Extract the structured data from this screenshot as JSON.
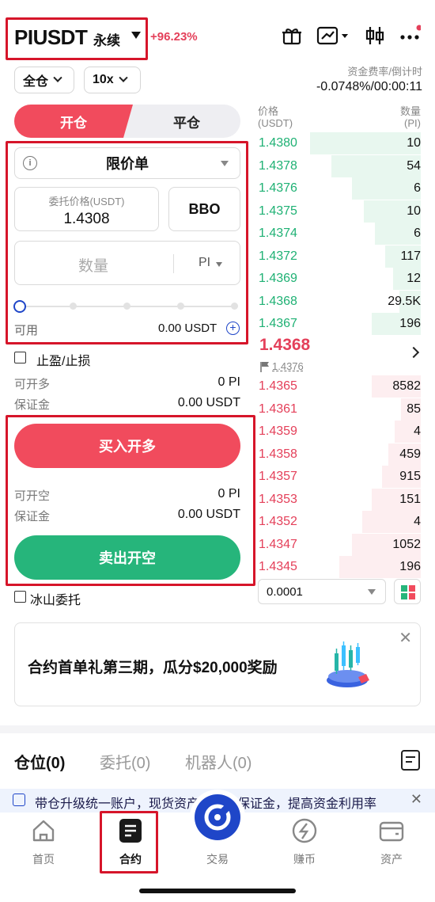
{
  "header": {
    "symbol": "PIUSDT",
    "contract_type": "永续",
    "change": "+96.23%"
  },
  "controls": {
    "margin_mode": "全仓",
    "leverage": "10x",
    "funding_label": "资金费率/倒计时",
    "funding_value": "-0.0748%/00:00:11"
  },
  "order_form": {
    "tab_open": "开仓",
    "tab_close": "平仓",
    "order_type": "限价单",
    "price_label": "委托价格(USDT)",
    "price_value": "1.4308",
    "bbo_label": "BBO",
    "qty_placeholder": "数量",
    "qty_unit": "PI",
    "available_label": "可用",
    "available_value": "0.00 USDT",
    "tpsl_label": "止盈/止损",
    "can_long_label": "可开多",
    "can_long_value": "0 PI",
    "margin_label": "保证金",
    "margin_long_value": "0.00 USDT",
    "buy_button": "买入开多",
    "can_short_label": "可开空",
    "can_short_value": "0 PI",
    "margin_short_value": "0.00 USDT",
    "sell_button": "卖出开空",
    "iceberg_label": "冰山委托"
  },
  "orderbook": {
    "price_header": "价格",
    "price_unit": "(USDT)",
    "qty_header": "数量",
    "qty_unit": "(PI)",
    "asks": [
      {
        "price": "1.4380",
        "qty": "10"
      },
      {
        "price": "1.4378",
        "qty": "54"
      },
      {
        "price": "1.4376",
        "qty": "6"
      },
      {
        "price": "1.4375",
        "qty": "10"
      },
      {
        "price": "1.4374",
        "qty": "6"
      },
      {
        "price": "1.4372",
        "qty": "117"
      },
      {
        "price": "1.4369",
        "qty": "12"
      },
      {
        "price": "1.4368",
        "qty": "29.5K"
      },
      {
        "price": "1.4367",
        "qty": "196"
      }
    ],
    "last_price": "1.4368",
    "mark_price": "1.4376",
    "bids": [
      {
        "price": "1.4365",
        "qty": "8582"
      },
      {
        "price": "1.4361",
        "qty": "85"
      },
      {
        "price": "1.4359",
        "qty": "4"
      },
      {
        "price": "1.4358",
        "qty": "459"
      },
      {
        "price": "1.4357",
        "qty": "915"
      },
      {
        "price": "1.4353",
        "qty": "151"
      },
      {
        "price": "1.4352",
        "qty": "4"
      },
      {
        "price": "1.4347",
        "qty": "1052"
      },
      {
        "price": "1.4345",
        "qty": "196"
      }
    ],
    "precision": "0.0001"
  },
  "banner": {
    "text": "合约首单礼第三期，瓜分$20,000奖励"
  },
  "positions": {
    "tabs": [
      "仓位(0)",
      "委托(0)",
      "机器人(0)"
    ]
  },
  "notice": {
    "text": "带仓升级统一账户，现货资产可作为保证金，提高资金利用率"
  },
  "nav": {
    "items": [
      "首页",
      "合约",
      "交易",
      "赚币",
      "资产"
    ]
  },
  "colors": {
    "buy": "#f14b5d",
    "sell": "#26b57b",
    "accent": "#1f46c8",
    "highlight_box": "#d6152a"
  }
}
